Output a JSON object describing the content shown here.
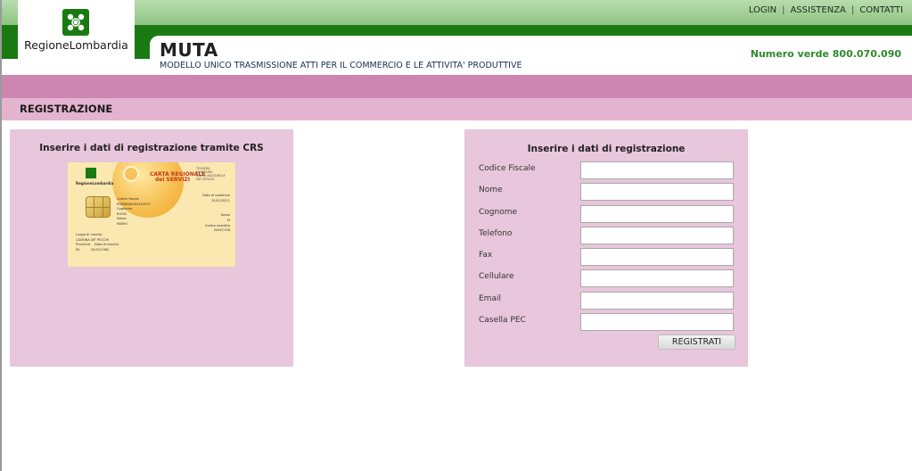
{
  "header": {
    "top_links": [
      "LOGIN",
      "ASSISTENZA",
      "CONTATTI"
    ],
    "logo_text": "RegioneLombardia",
    "title": "MUTA",
    "subtitle": "MODELLO UNICO TRASMISSIONE ATTI PER IL COMMERCIO E LE ATTIVITA' PRODUTTIVE",
    "phone": "Numero verde 800.070.090"
  },
  "section": {
    "title": "REGISTRAZIONE"
  },
  "crs_panel": {
    "title": "Inserire i dati di registrazione tramite CRS",
    "card": {
      "logo_text": "RegioneLombardia",
      "brand_line1": "CARTA REGIONALE",
      "brand_line2": "dei SERVIZI",
      "ts_line1": "TESSERA",
      "ts_line2": "SANITARIA",
      "ts_line3": "CARTA NAZIONALE",
      "ts_line4": "DEI SERVIZI",
      "fields_left": [
        "Codice fiscale",
        "RSSMRA62B25E205Y",
        "Cognome",
        "ROSSI",
        "Nome",
        "MARIO"
      ],
      "fields_right": [
        "Data di scadenza",
        "31/01/2011",
        "",
        "",
        "Sesso",
        "M",
        "Codice assistito",
        "544YC156"
      ],
      "fields_bottom": [
        "Luogo di nascita",
        "CASSINA DE' PECCHI",
        "Provincia    Data di nascita",
        "MI           25/02/1962"
      ]
    }
  },
  "form_panel": {
    "title": "Inserire i dati di registrazione",
    "fields": [
      {
        "label": "Codice Fiscale",
        "value": ""
      },
      {
        "label": "Nome",
        "value": ""
      },
      {
        "label": "Cognome",
        "value": ""
      },
      {
        "label": "Telefono",
        "value": ""
      },
      {
        "label": "Fax",
        "value": ""
      },
      {
        "label": "Cellulare",
        "value": ""
      },
      {
        "label": "Email",
        "value": ""
      },
      {
        "label": "Casella PEC",
        "value": ""
      }
    ],
    "submit_label": "REGISTRATI"
  },
  "colors": {
    "green_dark": "#1a7a12",
    "green_light": "#8fc582",
    "pink_dark": "#cd86b1",
    "pink_light": "#e4b3cf",
    "panel_bg": "#e8c6db",
    "phone_green": "#2f8a2a"
  }
}
